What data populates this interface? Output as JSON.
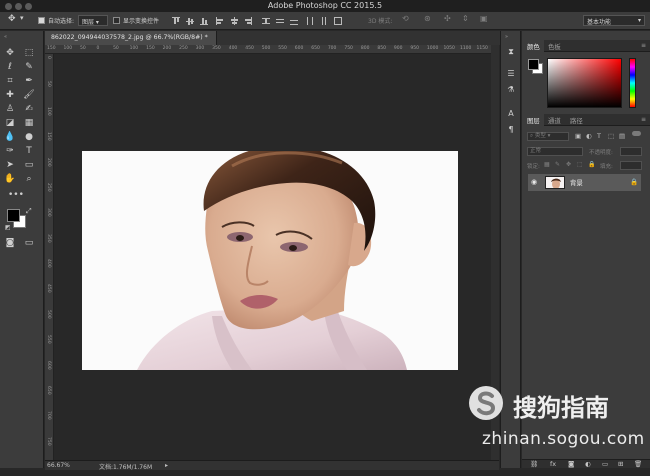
{
  "window": {
    "title": "Adobe Photoshop CC 2015.5"
  },
  "options_bar": {
    "auto_select_label": "自动选择:",
    "auto_select_value": "图层",
    "show_transform_label": "显示变换控件",
    "mode_3d_label": "3D 模式:",
    "workspace": "基本功能"
  },
  "document": {
    "tab_title": "862022_094944037578_2.jpg @ 66.7%(RGB/8#) *",
    "ruler_top": [
      "150",
      "100",
      "50",
      "0",
      "50",
      "100",
      "150",
      "200",
      "250",
      "300",
      "350",
      "400",
      "450",
      "500",
      "550",
      "600",
      "650",
      "700",
      "750",
      "800",
      "850",
      "900",
      "950",
      "1000",
      "1050",
      "1100",
      "1150"
    ],
    "ruler_left": [
      "0",
      "50",
      "100",
      "150",
      "200",
      "250",
      "300",
      "350",
      "400",
      "450",
      "500",
      "550",
      "600",
      "650",
      "700",
      "750"
    ]
  },
  "status": {
    "zoom": "66.67%",
    "doc_info": "文档:1.76M/1.76M"
  },
  "color_panel": {
    "tabs": [
      "颜色",
      "色板"
    ],
    "fg_color": "#000000",
    "bg_color": "#ffffff"
  },
  "layers_panel": {
    "tabs": [
      "图层",
      "通道",
      "路径"
    ],
    "kind_filter": "类型",
    "blend_mode": "正常",
    "opacity_label": "不透明度:",
    "lock_label": "锁定:",
    "fill_label": "填充:",
    "layers": [
      {
        "name": "背景"
      }
    ]
  },
  "watermark": {
    "text": "搜狗指南",
    "url": "zhinan.sogou.com"
  }
}
